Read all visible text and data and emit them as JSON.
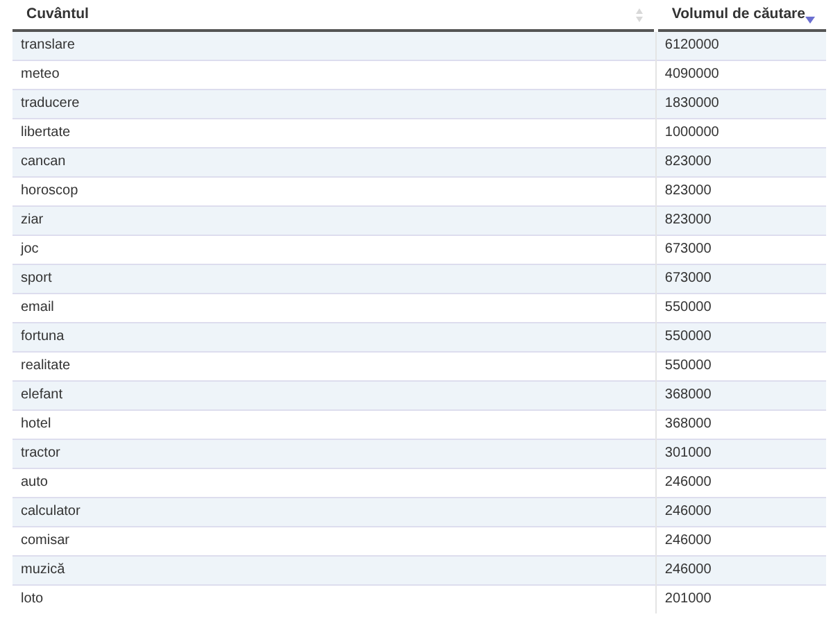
{
  "table": {
    "columns": [
      {
        "label": "Cuvântul",
        "sorted": false
      },
      {
        "label": "Volumul de căutare",
        "sorted": true,
        "descending": true
      }
    ],
    "rows": [
      [
        "translare",
        "6120000"
      ],
      [
        "meteo",
        "4090000"
      ],
      [
        "traducere",
        "1830000"
      ],
      [
        "libertate",
        "1000000"
      ],
      [
        "cancan",
        "823000"
      ],
      [
        "horoscop",
        "823000"
      ],
      [
        "ziar",
        "823000"
      ],
      [
        "joc",
        "673000"
      ],
      [
        "sport",
        "673000"
      ],
      [
        "email",
        "550000"
      ],
      [
        "fortuna",
        "550000"
      ],
      [
        "realitate",
        "550000"
      ],
      [
        "elefant",
        "368000"
      ],
      [
        "hotel",
        "368000"
      ],
      [
        "tractor",
        "301000"
      ],
      [
        "auto",
        "246000"
      ],
      [
        "calculator",
        "246000"
      ],
      [
        "comisar",
        "246000"
      ],
      [
        "muzică",
        "246000"
      ],
      [
        "loto",
        "201000"
      ]
    ]
  }
}
